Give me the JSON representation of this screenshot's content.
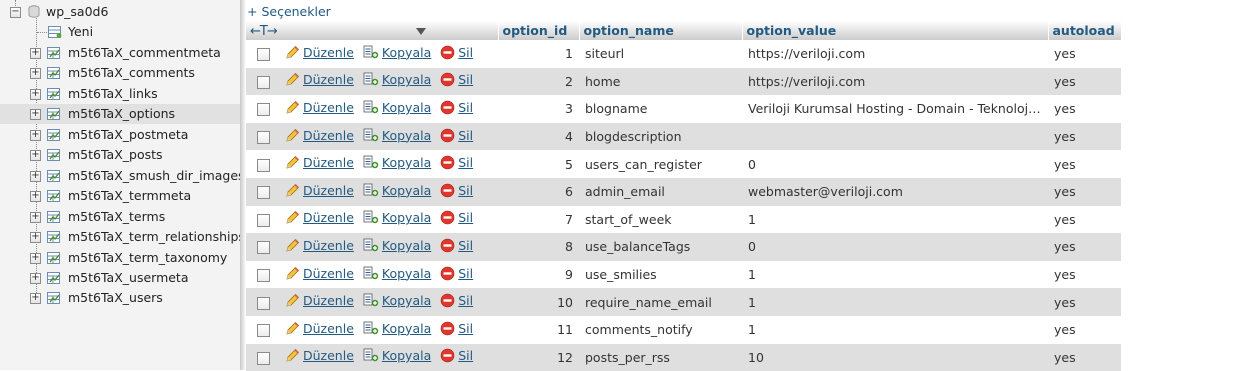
{
  "nav": {
    "database": "wp_sa0d6",
    "new_label": "Yeni",
    "tables": [
      "m5t6TaX_commentmeta",
      "m5t6TaX_comments",
      "m5t6TaX_links",
      "m5t6TaX_options",
      "m5t6TaX_postmeta",
      "m5t6TaX_posts",
      "m5t6TaX_smush_dir_images",
      "m5t6TaX_termmeta",
      "m5t6TaX_terms",
      "m5t6TaX_term_relationships",
      "m5t6TaX_term_taxonomy",
      "m5t6TaX_usermeta",
      "m5t6TaX_users"
    ],
    "selected_table": "m5t6TaX_options",
    "expand_symbol": "+",
    "collapse_symbol": "−"
  },
  "main": {
    "options_link": "+ Seçenekler",
    "arrows": "←T→",
    "columns": {
      "option_id": "option_id",
      "option_name": "option_name",
      "option_value": "option_value",
      "autoload": "autoload"
    },
    "actions": {
      "edit": "Düzenle",
      "copy": "Kopyala",
      "delete": "Sil"
    },
    "rows": [
      {
        "option_id": "1",
        "option_name": "siteurl",
        "option_value": "https://veriloji.com",
        "autoload": "yes"
      },
      {
        "option_id": "2",
        "option_name": "home",
        "option_value": "https://veriloji.com",
        "autoload": "yes"
      },
      {
        "option_id": "3",
        "option_name": "blogname",
        "option_value": "Veriloji Kurumsal Hosting - Domain - Teknoloji Blo...",
        "autoload": "yes"
      },
      {
        "option_id": "4",
        "option_name": "blogdescription",
        "option_value": "",
        "autoload": "yes"
      },
      {
        "option_id": "5",
        "option_name": "users_can_register",
        "option_value": "0",
        "autoload": "yes"
      },
      {
        "option_id": "6",
        "option_name": "admin_email",
        "option_value": "webmaster@veriloji.com",
        "autoload": "yes"
      },
      {
        "option_id": "7",
        "option_name": "start_of_week",
        "option_value": "1",
        "autoload": "yes"
      },
      {
        "option_id": "8",
        "option_name": "use_balanceTags",
        "option_value": "0",
        "autoload": "yes"
      },
      {
        "option_id": "9",
        "option_name": "use_smilies",
        "option_value": "1",
        "autoload": "yes"
      },
      {
        "option_id": "10",
        "option_name": "require_name_email",
        "option_value": "1",
        "autoload": "yes"
      },
      {
        "option_id": "11",
        "option_name": "comments_notify",
        "option_value": "1",
        "autoload": "yes"
      },
      {
        "option_id": "12",
        "option_name": "posts_per_rss",
        "option_value": "10",
        "autoload": "yes"
      }
    ]
  },
  "colors": {
    "link": "#235a81",
    "even_row": "#dfdfdf",
    "odd_row": "#ffffff",
    "nav_bg": "#f3f3f3",
    "nav_selected": "#e1e1e1"
  }
}
